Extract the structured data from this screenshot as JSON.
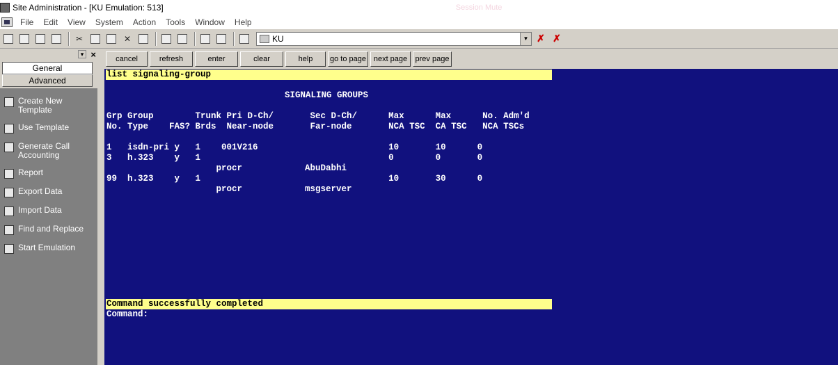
{
  "window": {
    "title": "Site Administration - [KU Emulation: 513]",
    "ghost_text": "Session     Mute"
  },
  "menu": [
    "File",
    "Edit",
    "View",
    "System",
    "Action",
    "Tools",
    "Window",
    "Help"
  ],
  "toolbar": {
    "session_value": "KU",
    "icons": [
      "new-icon",
      "open-icon",
      "save-icon",
      "copy-window-icon",
      "cut-icon",
      "copy-icon",
      "paste-icon",
      "delete-icon",
      "properties-icon",
      "layout1-icon",
      "layout2-icon",
      "print-preview-icon",
      "print-icon",
      "document-icon"
    ]
  },
  "sidebar": {
    "tabs": [
      "General",
      "Advanced"
    ],
    "items": [
      {
        "label": "Create New Template",
        "icon": "template-icon"
      },
      {
        "label": "Use Template",
        "icon": "template-icon"
      },
      {
        "label": "Generate Call Accounting",
        "icon": "accounting-icon"
      },
      {
        "label": "Report",
        "icon": "report-icon"
      },
      {
        "label": "Export Data",
        "icon": "export-icon"
      },
      {
        "label": "Import Data",
        "icon": "import-icon"
      },
      {
        "label": "Find and Replace",
        "icon": "find-replace-icon"
      },
      {
        "label": "Start Emulation",
        "icon": "emulation-icon"
      }
    ]
  },
  "commands": [
    "cancel",
    "refresh",
    "enter",
    "clear",
    "help",
    "go to page",
    "next page",
    "prev page"
  ],
  "terminal": {
    "command_line": "list signaling-group",
    "heading": "SIGNALING GROUPS",
    "header1": "Grp Group        Trunk Pri D-Ch/       Sec D-Ch/      Max      Max      No. Adm'd",
    "header2": "No. Type    FAS? Brds  Near-node       Far-node       NCA TSC  CA TSC   NCA TSCs",
    "rows": [
      "1   isdn-pri y   1    001V216                         10       10      0",
      "3   h.323    y   1                                    0        0       0",
      "                     procr            AbuDabhi",
      "99  h.323    y   1                                    10       30      0",
      "                     procr            msgserver"
    ],
    "status": "Command successfully completed",
    "prompt": "Command:"
  }
}
